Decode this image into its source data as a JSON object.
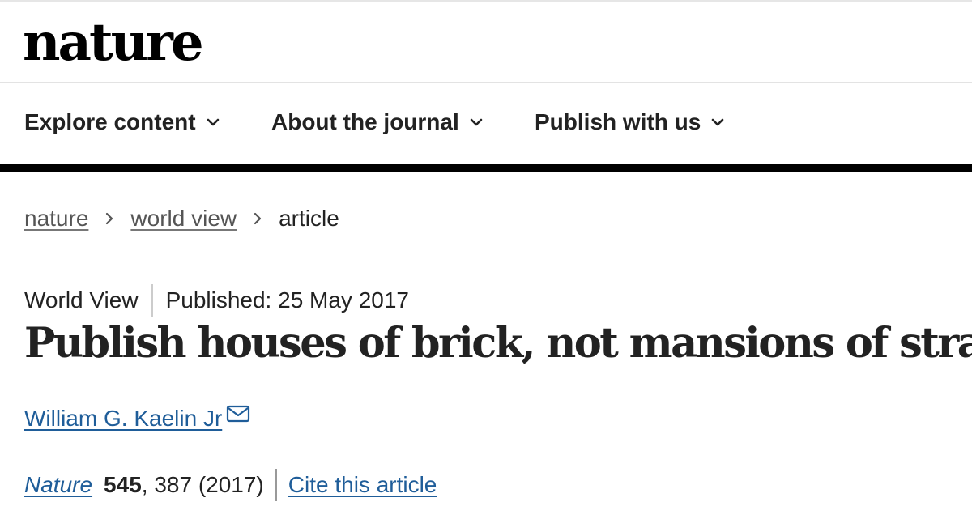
{
  "header": {
    "logo": "nature"
  },
  "nav": {
    "items": [
      {
        "label": "Explore content",
        "icon": "chevron-down-icon"
      },
      {
        "label": "About the journal",
        "icon": "chevron-down-icon"
      },
      {
        "label": "Publish with us",
        "icon": "chevron-down-icon"
      }
    ]
  },
  "breadcrumb": {
    "items": [
      "nature",
      "world view"
    ],
    "current": "article",
    "separator_icon": "chevron-right-icon"
  },
  "article": {
    "type": "World View",
    "published": "Published: 25 May 2017",
    "title": "Publish houses of brick, not mansions of straw",
    "author": "William G. Kaelin Jr",
    "author_icon": "mail-icon",
    "citation": {
      "journal": "Nature",
      "volume": "545",
      "pages_year": ", 387 (2017)",
      "cite_label": "Cite this article"
    }
  },
  "colors": {
    "link": "#1f5d99",
    "text": "#222222",
    "nav_rule": "#000000"
  }
}
